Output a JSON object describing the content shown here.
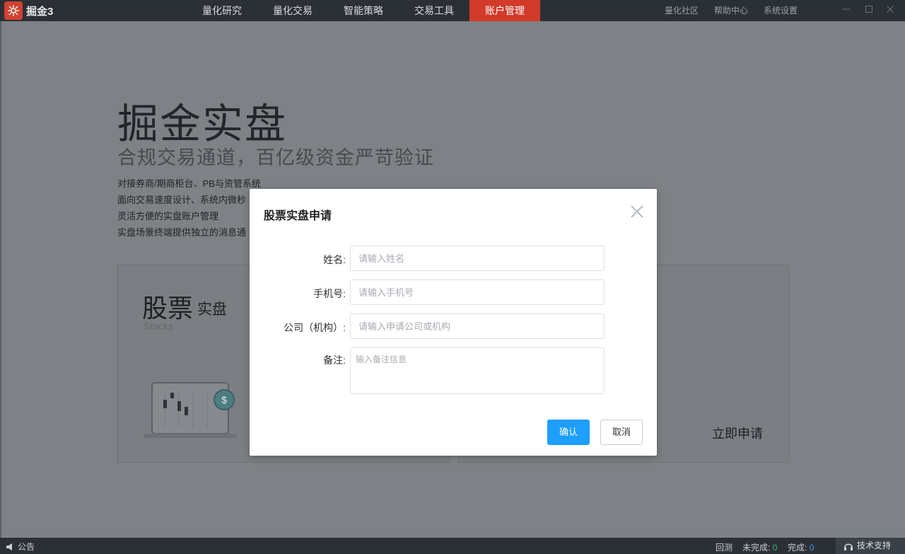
{
  "app": {
    "logo_text": "掘金3",
    "nav": [
      {
        "label": "量化研究"
      },
      {
        "label": "量化交易"
      },
      {
        "label": "智能策略"
      },
      {
        "label": "交易工具"
      },
      {
        "label": "账户管理"
      }
    ],
    "right_links": [
      "量化社区",
      "帮助中心",
      "系统设置"
    ],
    "accent_color": "#d23b2a"
  },
  "background": {
    "hero_title": "掘金实盘",
    "hero_subtitle": "合规交易通道，百亿级资金严苛验证",
    "hero_lines": [
      "对接券商/期商柜台、PB与资管系统",
      "面向交易速度设计、系统内微秒",
      "灵活方便的实盘账户管理",
      "实盘场景终端提供独立的消息通"
    ],
    "card_left": {
      "title": "股票",
      "title_small": "实盘",
      "subtitle_en": "Stocks"
    },
    "card_right": {
      "apply_label": "立即申请"
    }
  },
  "modal": {
    "title": "股票实盘申请",
    "fields": {
      "name": {
        "label": "姓名:",
        "placeholder": "请输入姓名",
        "value": ""
      },
      "phone": {
        "label": "手机号:",
        "placeholder": "请输入手机号",
        "value": ""
      },
      "company": {
        "label": "公司（机构）:",
        "placeholder": "请输入申请公司或机构",
        "value": ""
      },
      "remark": {
        "label": "备注:",
        "placeholder": "输入备注信息",
        "value": ""
      }
    },
    "confirm_label": "确认",
    "cancel_label": "取消",
    "primary_color": "#1e9eff"
  },
  "statusbar": {
    "notice_label": "公告",
    "backtest_label": "回测",
    "incomplete_label": "未完成:",
    "incomplete_count": "0",
    "complete_label": "完成:",
    "complete_count": "0",
    "support_label": "技术支持"
  }
}
